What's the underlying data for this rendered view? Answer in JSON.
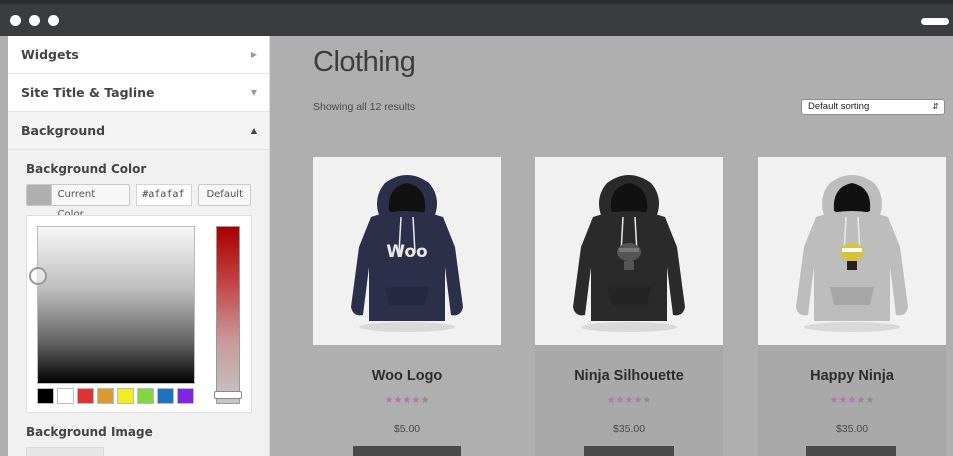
{
  "window": {
    "traffic_lights": [
      "dot-1",
      "dot-2",
      "dot-3"
    ]
  },
  "sidebar": {
    "sections": [
      {
        "label": "Widgets",
        "arrow": "▶"
      },
      {
        "label": "Site Title & Tagline",
        "arrow": "▼"
      },
      {
        "label": "Background",
        "arrow": "▲"
      }
    ],
    "background": {
      "color_label": "Background Color",
      "current_color_label": "Current Color",
      "hex_value": "#afafaf",
      "default_label": "Default",
      "image_label": "Background Image",
      "palette": [
        "#000000",
        "#ffffff",
        "#dd3333",
        "#dd9933",
        "#eeee22",
        "#81d742",
        "#1e73be",
        "#8224e3"
      ]
    }
  },
  "main": {
    "title": "Clothing",
    "result_count": "Showing all 12 results",
    "sorting": "Default sorting",
    "products": [
      {
        "name": "Woo Logo",
        "price": "$5.00",
        "rating": 4,
        "hoodie_color": "#2b2f4a",
        "logo": "Woo"
      },
      {
        "name": "Ninja Silhouette",
        "price": "$35.00",
        "rating": 4,
        "hoodie_color": "#2a2a2a",
        "logo": ""
      },
      {
        "name": "Happy Ninja",
        "price": "$35.00",
        "rating": 3,
        "hoodie_color": "#bdbdbd",
        "logo": ""
      }
    ]
  }
}
